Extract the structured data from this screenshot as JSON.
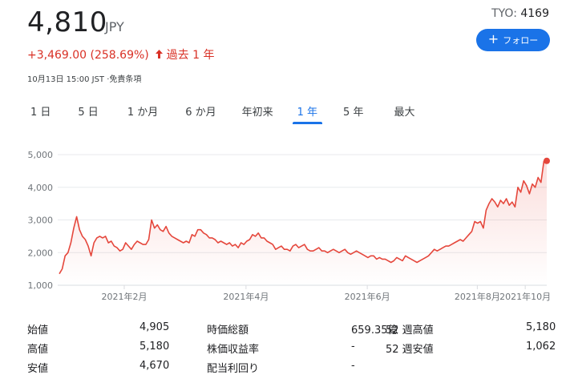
{
  "header": {
    "price": "4,810",
    "currency": "JPY",
    "exchange": "TYO:",
    "ticker": "4169",
    "follow_label": "フォロー",
    "change": "+3,469.00 (258.69%)",
    "change_period": "過去 1 年",
    "timestamp": "10月13日 15:00 JST ·免責条項"
  },
  "tabs": [
    {
      "label": "1 日",
      "active": false
    },
    {
      "label": "5 日",
      "active": false
    },
    {
      "label": "1 か月",
      "active": false
    },
    {
      "label": "6 か月",
      "active": false
    },
    {
      "label": "年初来",
      "active": false
    },
    {
      "label": "1 年",
      "active": true
    },
    {
      "label": "5 年",
      "active": false
    },
    {
      "label": "最大",
      "active": false
    }
  ],
  "colors": {
    "accent": "#1a73e8",
    "negative_text": "#d93025",
    "line": "#e5473c"
  },
  "chart_data": {
    "type": "line",
    "y_ticks": [
      "5,000",
      "4,000",
      "3,000",
      "2,000",
      "1,000"
    ],
    "y_tick_values": [
      5000,
      4000,
      3000,
      2000,
      1000
    ],
    "ylim": [
      1000,
      5300
    ],
    "x_ticks": [
      "2021年2月",
      "2021年4月",
      "2021年6月",
      "2021年8月",
      "2021年10月"
    ],
    "x_tick_positions": [
      0.136,
      0.385,
      0.633,
      0.858,
      0.956
    ],
    "grid": true,
    "series": [
      {
        "values": [
          1350,
          1500,
          1900,
          2000,
          2300,
          2750,
          3100,
          2700,
          2500,
          2400,
          2200,
          1900,
          2300,
          2450,
          2500,
          2450,
          2500,
          2300,
          2350,
          2200,
          2150,
          2050,
          2100,
          2300,
          2200,
          2100,
          2250,
          2350,
          2300,
          2250,
          2250,
          2400,
          3000,
          2750,
          2850,
          2700,
          2650,
          2800,
          2600,
          2500,
          2450,
          2400,
          2350,
          2300,
          2350,
          2300,
          2550,
          2500,
          2700,
          2700,
          2600,
          2550,
          2450,
          2450,
          2400,
          2300,
          2350,
          2300,
          2250,
          2300,
          2200,
          2250,
          2150,
          2300,
          2250,
          2350,
          2400,
          2550,
          2500,
          2600,
          2450,
          2450,
          2350,
          2300,
          2250,
          2100,
          2150,
          2200,
          2100,
          2100,
          2050,
          2200,
          2250,
          2150,
          2200,
          2250,
          2100,
          2050,
          2050,
          2100,
          2150,
          2050,
          2050,
          2000,
          2050,
          2100,
          2050,
          2000,
          2050,
          2100,
          2000,
          1950,
          2000,
          2050,
          2000,
          1950,
          1900,
          1850,
          1900,
          1900,
          1800,
          1850,
          1800,
          1800,
          1750,
          1700,
          1750,
          1850,
          1800,
          1750,
          1900,
          1850,
          1800,
          1750,
          1700,
          1750,
          1800,
          1850,
          1900,
          2000,
          2100,
          2050,
          2100,
          2150,
          2200,
          2200,
          2250,
          2300,
          2350,
          2400,
          2350,
          2450,
          2550,
          2650,
          2950,
          2900,
          2950,
          2750,
          3300,
          3500,
          3650,
          3550,
          3400,
          3600,
          3500,
          3650,
          3450,
          3550,
          3400,
          4000,
          3850,
          4200,
          4050,
          3800,
          4100,
          4000,
          4300,
          4150,
          4800,
          4810
        ]
      }
    ]
  },
  "stats": [
    {
      "label": "始値",
      "value": "4,905"
    },
    {
      "label": "高値",
      "value": "5,180"
    },
    {
      "label": "安値",
      "value": "4,670"
    },
    {
      "label": "時価総額",
      "value": "659.35億"
    },
    {
      "label": "株価収益率",
      "value": "-"
    },
    {
      "label": "配当利回り",
      "value": "-"
    },
    {
      "label": "52 週高値",
      "value": "5,180"
    },
    {
      "label": "52 週安値",
      "value": "1,062"
    }
  ]
}
